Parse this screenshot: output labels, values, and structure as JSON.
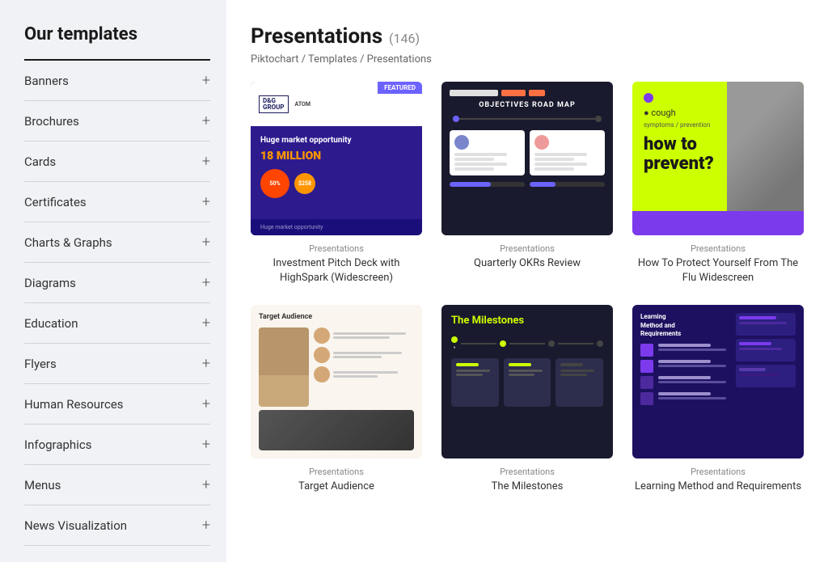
{
  "sidebar": {
    "title": "Our templates",
    "items": [
      {
        "label": "Banners",
        "icon": "+"
      },
      {
        "label": "Brochures",
        "icon": "+"
      },
      {
        "label": "Cards",
        "icon": "+"
      },
      {
        "label": "Certificates",
        "icon": "+"
      },
      {
        "label": "Charts & Graphs",
        "icon": "+"
      },
      {
        "label": "Diagrams",
        "icon": "+"
      },
      {
        "label": "Education",
        "icon": "+"
      },
      {
        "label": "Flyers",
        "icon": "+"
      },
      {
        "label": "Human Resources",
        "icon": "+"
      },
      {
        "label": "Infographics",
        "icon": "+"
      },
      {
        "label": "Menus",
        "icon": "+"
      },
      {
        "label": "News Visualization",
        "icon": "+"
      }
    ]
  },
  "main": {
    "title": "Presentations",
    "count": "(146)",
    "breadcrumb": "Piktochart / Templates / Presentations"
  },
  "templates": [
    {
      "id": 1,
      "category": "Presentations",
      "name": "Investment Pitch Deck with HighSpark (Widescreen)"
    },
    {
      "id": 2,
      "category": "Presentations",
      "name": "Quarterly OKRs Review"
    },
    {
      "id": 3,
      "category": "Presentations",
      "name": "How To Protect Yourself From The Flu Widescreen"
    },
    {
      "id": 4,
      "category": "Presentations",
      "name": "Target Audience"
    },
    {
      "id": 5,
      "category": "Presentations",
      "name": "The Milestones"
    },
    {
      "id": 6,
      "category": "Presentations",
      "name": "Learning Method and Requirements"
    }
  ],
  "icons": {
    "plus": "+",
    "slash": "/"
  }
}
